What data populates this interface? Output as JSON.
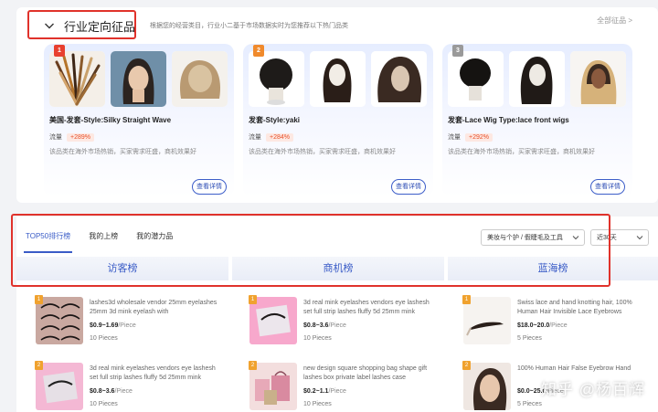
{
  "section": {
    "title": "行业定向征品",
    "desc": "根据您的经营类目，行业小二基于市场数据实时为您推荐以下热门品类",
    "all_link": "全部征品 >"
  },
  "cards": [
    {
      "rank": "1",
      "rank_color": "#e8402f",
      "title": "美国-发套-Style:Silky Straight Wave",
      "flow_label": "流量",
      "flow_value": "+289%",
      "desc": "该品类在海外市场热销，买家需求旺盛，商机效果好",
      "button": "查看详情"
    },
    {
      "rank": "2",
      "rank_color": "#f08a2c",
      "title": "发套-Style:yaki",
      "flow_label": "流量",
      "flow_value": "+284%",
      "desc": "该品类在海外市场热销，买家需求旺盛，商机效果好",
      "button": "查看详情"
    },
    {
      "rank": "3",
      "rank_color": "#9a9a9a",
      "title": "发套-Lace Wig Type:lace front wigs",
      "flow_label": "流量",
      "flow_value": "+292%",
      "desc": "该品类在海外市场热销，买家需求旺盛，商机效果好",
      "button": "查看详情"
    }
  ],
  "tabs": [
    "TOP50排行榜",
    "我的上榜",
    "我的潜力品"
  ],
  "filters": {
    "category": "美妆与个护 / 假睫毛及工具",
    "period": "近30天"
  },
  "columns": [
    "访客榜",
    "商机榜",
    "蓝海榜"
  ],
  "products": [
    [
      {
        "rank": "1",
        "title": "lashes3d wholesale vendor 25mm eyelashes 25mm 3d mink eyelash with",
        "price": "$0.9~1.69",
        "unit": "/Piece",
        "moq": "10 Pieces"
      },
      {
        "rank": "2",
        "title": "3d real mink eyelashes vendors eye lashesh set full strip lashes fluffy 5d 25mm mink",
        "price": "$0.8~3.6",
        "unit": "/Piece",
        "moq": "10 Pieces"
      }
    ],
    [
      {
        "rank": "1",
        "title": "3d real mink eyelashes vendors eye lashesh set full strip lashes fluffy 5d 25mm mink",
        "price": "$0.8~3.6",
        "unit": "/Piece",
        "moq": "10 Pieces"
      },
      {
        "rank": "2",
        "title": "new design square shopping bag shape gift lashes box private label lashes case",
        "price": "$0.2~1.1",
        "unit": "/Piece",
        "moq": "10 Pieces"
      }
    ],
    [
      {
        "rank": "1",
        "title": "Swiss lace and hand knotting hair, 100% Human Hair Invisible Lace Eyebrows",
        "price": "$18.0~20.0",
        "unit": "/Piece",
        "moq": "5 Pieces"
      },
      {
        "rank": "2",
        "title": "100% Human Hair False Eyebrow Hand",
        "price": "$0.0~25.0",
        "unit": "/Piece",
        "moq": "5 Pieces"
      }
    ]
  ],
  "watermark": "知乎 @杨百辉"
}
